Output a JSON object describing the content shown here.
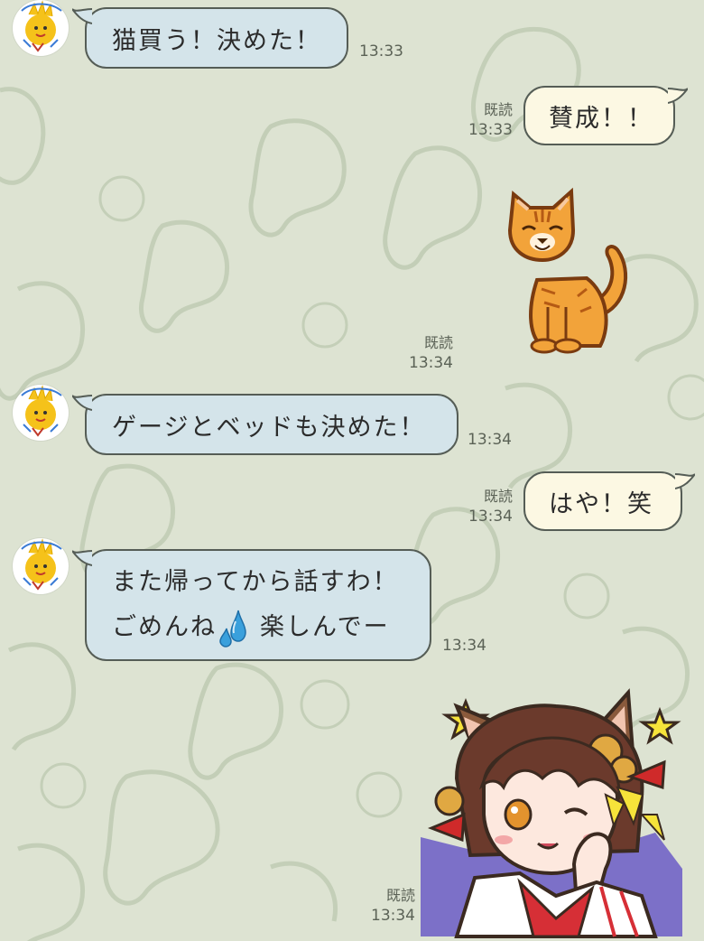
{
  "colors": {
    "background": "#dde3d2",
    "incoming_bubble": "#d4e4ea",
    "outgoing_bubble": "#fcf8e3",
    "bubble_border": "#555d56",
    "timestamp_text": "#5b6256"
  },
  "messages": [
    {
      "direction": "incoming",
      "text": "猫買う！決めた！",
      "time": "13:33"
    },
    {
      "direction": "outgoing",
      "text": "賛成！！",
      "read": "既読",
      "time": "13:33"
    },
    {
      "direction": "outgoing",
      "type": "sticker",
      "sticker_icon": "orange-tabby-cat-sticker",
      "read": "既読",
      "time": "13:34"
    },
    {
      "direction": "incoming",
      "text": "ゲージとベッドも決めた！",
      "time": "13:34"
    },
    {
      "direction": "outgoing",
      "text": "はや！笑",
      "read": "既読",
      "time": "13:34"
    },
    {
      "direction": "incoming",
      "line1": "また帰ってから話すわ！",
      "line2_before": "ごめんね",
      "emoji_icon": "sweat-droplets-emoji",
      "line2_after": "楽しんでー",
      "time": "13:34"
    },
    {
      "direction": "outgoing",
      "type": "sticker",
      "sticker_icon": "cat-eared-girl-wink-sticker",
      "read": "既読",
      "time": "13:34"
    }
  ]
}
